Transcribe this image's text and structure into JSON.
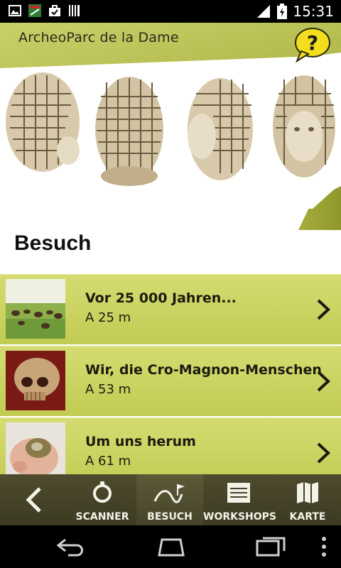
{
  "status_bar": {
    "time": "15:31",
    "icons_left": [
      "image-icon",
      "app-badge-icon",
      "briefcase-icon",
      "barcode-icon"
    ],
    "icons_right": [
      "signal-icon",
      "battery-icon"
    ]
  },
  "header": {
    "app_title": "ArcheoParc de la Dame",
    "help_glyph": "?"
  },
  "section": {
    "title": "Besuch"
  },
  "stations": [
    {
      "title": "Vor 25 000 Jahren...",
      "distance": "A 25 m",
      "thumb": "mammoth-herd-landscape"
    },
    {
      "title": "Wir, die Cro-Magnon-Menschen",
      "distance": "A 53 m",
      "thumb": "cro-magnon-skull"
    },
    {
      "title": "Um uns herum",
      "distance": "A 61 m",
      "thumb": "hand-holding-fossil"
    }
  ],
  "tabbar": {
    "tabs": [
      {
        "label": "SCANNER",
        "icon": "scanner-ring-icon"
      },
      {
        "label": "BESUCH",
        "icon": "path-flag-icon",
        "active": true
      },
      {
        "label": "WORKSHOPS",
        "icon": "notebook-icon"
      },
      {
        "label": "KARTE",
        "icon": "map-icon"
      }
    ]
  },
  "colors": {
    "accent_olive": "#9aa23a",
    "list_green": "#c8d05a",
    "tab_bar": "#45432a",
    "help_yellow": "#f4dc1e"
  }
}
